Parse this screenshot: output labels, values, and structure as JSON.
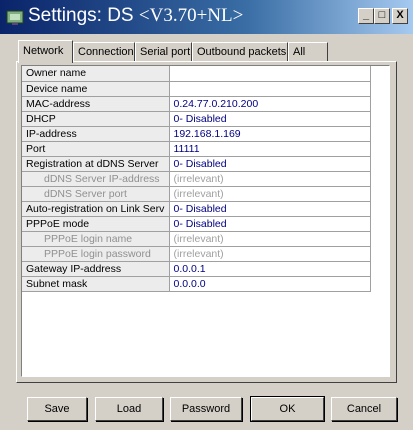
{
  "window": {
    "title_prefix": "Settings: DS ",
    "title_version": "<V3.70+NL>"
  },
  "titlebar_buttons": {
    "minimize": "_",
    "maximize": "□",
    "close": "X"
  },
  "tabs": [
    "Network",
    "Connection",
    "Serial port",
    "Outbound packets",
    "All"
  ],
  "active_tab": "Network",
  "settings": [
    {
      "name": "Owner name",
      "value": ""
    },
    {
      "name": "Device name",
      "value": ""
    },
    {
      "name": "MAC-address",
      "value": "0.24.77.0.210.200"
    },
    {
      "name": "DHCP",
      "value": "0- Disabled"
    },
    {
      "name": "IP-address",
      "value": "192.168.1.169"
    },
    {
      "name": "Port",
      "value": "11111"
    },
    {
      "name": "Registration at dDNS Server",
      "value": "0- Disabled"
    },
    {
      "name": "dDNS Server IP-address",
      "value": "(irrelevant)"
    },
    {
      "name": "dDNS Server port",
      "value": "(irrelevant)"
    },
    {
      "name": "Auto-registration on Link Serv",
      "value": "0- Disabled"
    },
    {
      "name": "PPPoE mode",
      "value": "0- Disabled"
    },
    {
      "name": "PPPoE login name",
      "value": "(irrelevant)"
    },
    {
      "name": "PPPoE login password",
      "value": "(irrelevant)"
    },
    {
      "name": "Gateway IP-address",
      "value": "0.0.0.1"
    },
    {
      "name": "Subnet mask",
      "value": "0.0.0.0"
    }
  ],
  "buttons": {
    "save": "Save",
    "load": "Load",
    "password": "Password",
    "ok": "OK",
    "cancel": "Cancel"
  }
}
